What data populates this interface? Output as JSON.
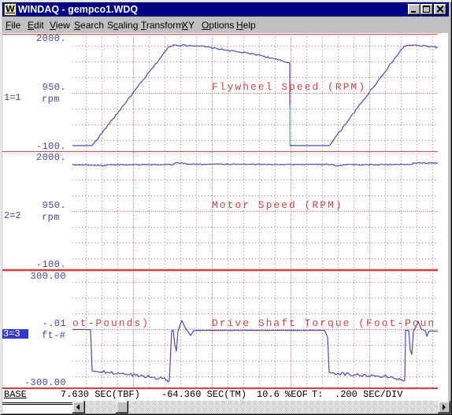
{
  "window": {
    "title": "WINDAQ - gempco1.WDQ",
    "app_icon_glyph": "W",
    "controls": [
      "minimize",
      "maximize",
      "close"
    ]
  },
  "menu": [
    {
      "label": "File",
      "mnemonic_index": 0
    },
    {
      "label": "Edit",
      "mnemonic_index": 0
    },
    {
      "label": "View",
      "mnemonic_index": 0
    },
    {
      "label": "Search",
      "mnemonic_index": 0
    },
    {
      "label": "Scaling",
      "mnemonic_index": 1
    },
    {
      "label": "Transform",
      "mnemonic_index": 0
    },
    {
      "label": "XY",
      "mnemonic_index": 0
    },
    {
      "label": "Options",
      "mnemonic_index": 0
    },
    {
      "label": "Help",
      "mnemonic_index": 0
    }
  ],
  "channels": [
    {
      "id": "1=1",
      "active": false,
      "title_fragments": [
        "Flywheel Speed (RPM)"
      ]
    },
    {
      "id": "2=2",
      "active": false,
      "title_fragments": [
        "Motor Speed (RPM)"
      ]
    },
    {
      "id": "3=3",
      "active": true,
      "title_fragments": [
        "Drive Shaft Torque (Foot-Poun",
        "ot-Pounds)"
      ]
    }
  ],
  "status": {
    "base_label": "BASE",
    "tbf": "7.630 SEC(TBF)",
    "tm": "-64.360 SEC(TM)",
    "eof": "10.6 %EOF",
    "t_label": "T:",
    "sec_per_div": ".200 SEC/DIV"
  },
  "scrollbar": {
    "position_fraction": 0.09
  },
  "colors": {
    "title_bar": "#000080",
    "trace": "#4a4ab4",
    "connector": "#3a9a9a",
    "grid": "#cc5a5a",
    "separator": "#d84a4a",
    "separator_active": "#e03c3c",
    "channel_title": "#c84a4a",
    "axis_label": "#4646a6",
    "active_channel_bg": "#3a3ad0"
  },
  "chart_data": {
    "type": "line",
    "x_unit": "s",
    "x_range": [
      0,
      4.64
    ],
    "sec_per_div": 0.2,
    "grid": true,
    "series": [
      {
        "name": "Flywheel Speed (RPM)",
        "channel": "1=1",
        "unit": "rpm",
        "ylim": [
          -100,
          2000
        ],
        "tick_labels": [
          "2000.",
          "950.",
          "-100."
        ],
        "segments": [
          [
            [
              0,
              0,
              0
            ],
            [
              0.25,
              0,
              15
            ],
            [
              1.23,
              1775,
              14
            ],
            [
              1.28,
              1800,
              14
            ],
            [
              1.58,
              1790,
              14
            ],
            [
              1.98,
              1704,
              14
            ],
            [
              2.38,
              1619,
              14
            ],
            [
              2.76,
              1479,
              0
            ],
            [
              2.76,
              732,
              0
            ]
          ],
          [
            [
              2.76,
              0,
              0
            ],
            [
              3.26,
              0,
              15
            ],
            [
              4.21,
              1775,
              14
            ],
            [
              4.28,
              1800,
              14
            ],
            [
              4.64,
              1765,
              0
            ]
          ]
        ],
        "connector": {
          "t": 2.76,
          "from": 732,
          "to": 0
        }
      },
      {
        "name": "Motor Speed (RPM)",
        "channel": "2=2",
        "unit": "rpm",
        "ylim": [
          -100,
          2000
        ],
        "tick_labels": [
          "2000.",
          "950.",
          "-100."
        ],
        "segments": [
          [
            [
              0,
              1764,
              8
            ],
            [
              0.3,
              1752,
              8
            ],
            [
              0.38,
              1738,
              8
            ],
            [
              0.45,
              1760,
              8
            ],
            [
              1.28,
              1766,
              8
            ],
            [
              1.31,
              1795,
              8
            ],
            [
              1.4,
              1790,
              8
            ],
            [
              1.5,
              1770,
              8
            ],
            [
              3.3,
              1765,
              8
            ],
            [
              3.36,
              1738,
              8
            ],
            [
              3.45,
              1760,
              8
            ],
            [
              4.3,
              1766,
              8
            ],
            [
              4.33,
              1795,
              8
            ],
            [
              4.64,
              1790,
              0
            ]
          ]
        ]
      },
      {
        "name": "Drive Shaft Torque (Foot-Pounds)",
        "channel": "3=3",
        "unit": "ft-#",
        "ylim": [
          -300,
          300
        ],
        "tick_labels": [
          "300.00",
          "-.01",
          "-300.00"
        ],
        "segments": [
          [
            [
              0,
              -2,
              1
            ],
            [
              0.23,
              -2,
              0
            ],
            [
              0.25,
              -212,
              0
            ],
            [
              0.3,
              -215,
              8
            ],
            [
              0.6,
              -225,
              8
            ],
            [
              0.9,
              -238,
              8
            ],
            [
              1.15,
              -250,
              8
            ],
            [
              1.2,
              -258,
              0
            ],
            [
              1.21,
              -268,
              0
            ],
            [
              1.23,
              -262,
              0
            ],
            [
              1.26,
              -8,
              0
            ],
            [
              1.28,
              -6,
              0
            ],
            [
              1.3,
              -80,
              0
            ],
            [
              1.32,
              -112,
              0
            ],
            [
              1.34,
              -12,
              0
            ],
            [
              1.37,
              24,
              0
            ],
            [
              1.39,
              44,
              0
            ],
            [
              1.43,
              8,
              0
            ],
            [
              1.46,
              -8,
              0
            ],
            [
              1.5,
              -32,
              0
            ],
            [
              1.54,
              -8,
              0
            ],
            [
              1.6,
              -6,
              1
            ],
            [
              3.2,
              -6,
              0
            ],
            [
              3.24,
              -40,
              0
            ],
            [
              3.26,
              -220,
              0
            ],
            [
              3.3,
              -222,
              8
            ],
            [
              3.6,
              -232,
              8
            ],
            [
              3.9,
              -240,
              8
            ],
            [
              4.15,
              -250,
              8
            ],
            [
              4.18,
              -256,
              0
            ],
            [
              4.2,
              -264,
              0
            ],
            [
              4.22,
              -260,
              0
            ],
            [
              4.23,
              -6,
              0
            ],
            [
              4.27,
              -6,
              0
            ],
            [
              4.29,
              -108,
              0
            ],
            [
              4.31,
              -128,
              0
            ],
            [
              4.33,
              -12,
              0
            ],
            [
              4.37,
              20,
              0
            ],
            [
              4.39,
              40,
              0
            ],
            [
              4.43,
              0,
              0
            ],
            [
              4.48,
              -8,
              0
            ],
            [
              4.5,
              -36,
              0
            ],
            [
              4.53,
              -10,
              1
            ],
            [
              4.64,
              -10,
              0
            ]
          ]
        ]
      }
    ]
  }
}
